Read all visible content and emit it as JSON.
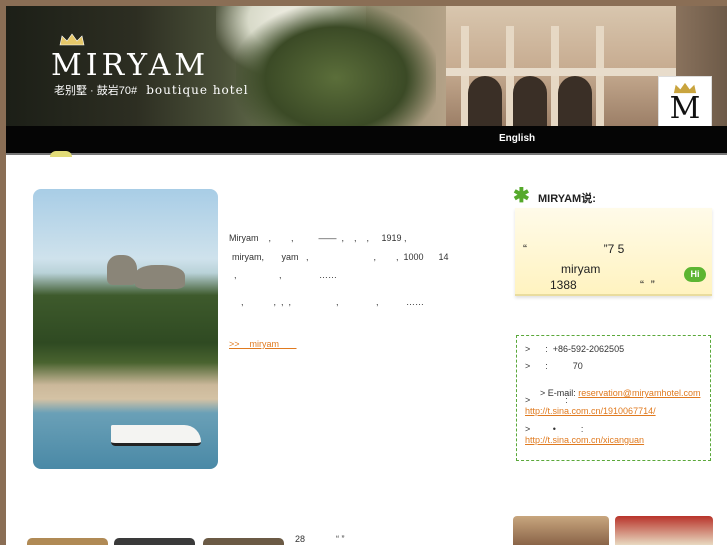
{
  "header": {
    "brand": "MIRYAM",
    "sub_cn": "老别墅 · 鼓岩70#",
    "sub_en": "boutique hotel",
    "badge_letter": "M"
  },
  "nav": {
    "english": "English"
  },
  "intro": {
    "line1": "Miryam    ,        ,          ——  ,    ,    ,     1919 ,",
    "line2": "miryam,       yam   ,                          ,        ,  1000      14",
    "line3": ",                 ,               ……",
    "line4": ",            ,  ,  ,                  ,               ,           ……",
    "more_link": ">>    miryam       "
  },
  "says": {
    "title": "MIRYAM说:",
    "q1": "“                       ”7 5",
    "q2": "miryam",
    "q3": "1388                   “  ”",
    "hi": "Hi"
  },
  "contact": {
    "phone": ">      :  +86-592-2062505",
    "addr": ">      :          70",
    "email_label": "> E-mail: ",
    "email": "reservation@miryamhotel.com",
    "weibo1_label": ">              :",
    "weibo1": "http://t.sina.com.cn/1910067714/",
    "weibo2_label": ">         •          :",
    "weibo2": "http://t.sina.com.cn/xicanguan"
  },
  "bottom": {
    "count": "28",
    "mark": "“ ”"
  },
  "colors": {
    "accent_orange": "#e07a1f",
    "accent_green": "#55a92b",
    "nav_black": "#050505"
  }
}
